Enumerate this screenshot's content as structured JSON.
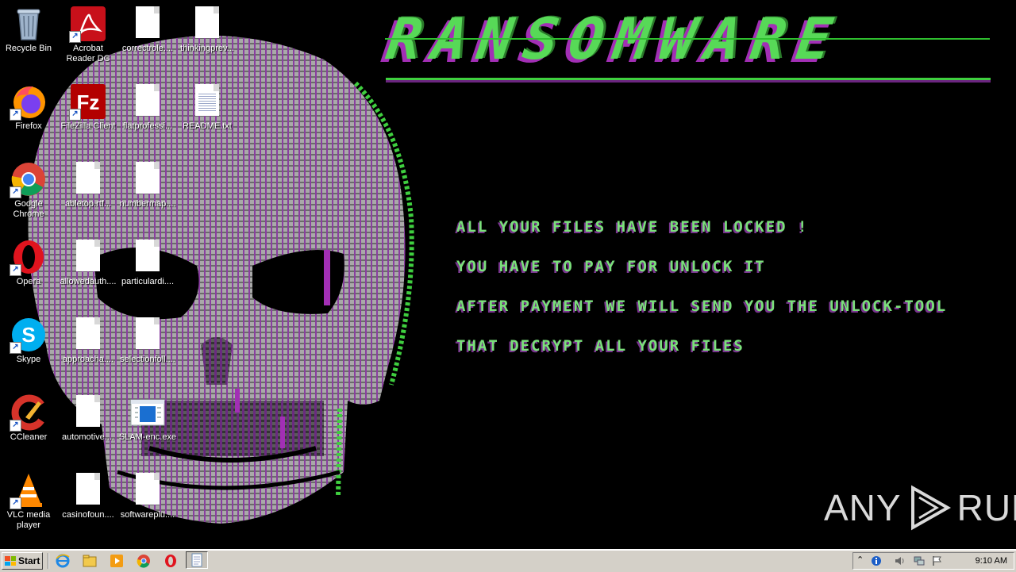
{
  "desktop": {
    "icons": [
      {
        "label": "Recycle Bin",
        "icon": "recycle-bin-icon"
      },
      {
        "label": "Acrobat Reader DC",
        "icon": "acrobat-icon"
      },
      {
        "label": "correctrole....",
        "icon": "document-icon"
      },
      {
        "label": "thinkingprev...",
        "icon": "document-icon"
      },
      {
        "label": "Firefox",
        "icon": "firefox-icon"
      },
      {
        "label": "FileZilla Client",
        "icon": "filezilla-icon"
      },
      {
        "label": "flatprofessi...",
        "icon": "document-icon"
      },
      {
        "label": "README.txt",
        "icon": "text-file-icon"
      },
      {
        "label": "Google Chrome",
        "icon": "chrome-icon"
      },
      {
        "label": "abletop.rtf...",
        "icon": "document-icon"
      },
      {
        "label": "numbermap....",
        "icon": "document-icon"
      },
      {
        "label": "Opera",
        "icon": "opera-icon"
      },
      {
        "label": "allowedauth....",
        "icon": "document-icon"
      },
      {
        "label": "particulardi....",
        "icon": "document-icon"
      },
      {
        "label": "Skype",
        "icon": "skype-icon"
      },
      {
        "label": "approacha....",
        "icon": "document-icon"
      },
      {
        "label": "selectionfoll....",
        "icon": "document-icon"
      },
      {
        "label": "CCleaner",
        "icon": "ccleaner-icon"
      },
      {
        "label": "automotive....",
        "icon": "document-icon"
      },
      {
        "label": "SLAM-enc.exe",
        "icon": "exe-icon"
      },
      {
        "label": "VLC media player",
        "icon": "vlc-icon"
      },
      {
        "label": "casinofoun....",
        "icon": "document-icon"
      },
      {
        "label": "softwareplu....",
        "icon": "document-icon"
      }
    ]
  },
  "wallpaper": {
    "title": "RANSOMWARE",
    "messages": [
      "ALL YOUR FILES HAVE BEEN LOCKED !",
      "YOU HAVE TO PAY FOR UNLOCK IT",
      "AFTER PAYMENT WE WILL SEND YOU THE UNLOCK-TOOL",
      "THAT DECRYPT ALL YOUR FILES"
    ],
    "colors": {
      "green": "#57d957",
      "purple": "#a22fb5"
    }
  },
  "watermark": {
    "left": "ANY",
    "right": "RUN"
  },
  "taskbar": {
    "start_label": "Start",
    "quick_launch": [
      "ie-icon",
      "explorer-icon",
      "media-player-icon",
      "chrome-icon",
      "opera-icon",
      "notepad-icon"
    ],
    "tray_icons": [
      "show-hidden-icon",
      "info-icon",
      "volume-icon",
      "network-icon",
      "flag-icon"
    ],
    "clock": "9:10 AM"
  }
}
